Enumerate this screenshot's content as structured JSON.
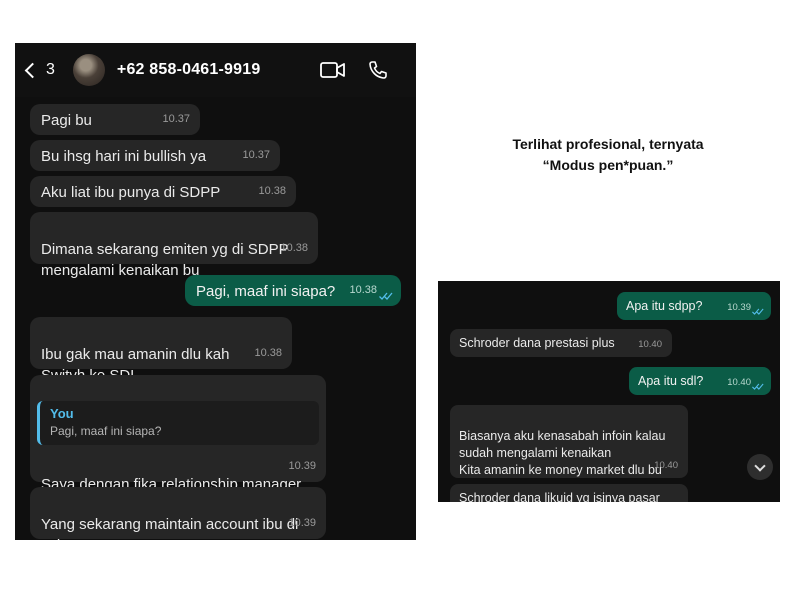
{
  "left_chat": {
    "header": {
      "back_count": "3",
      "contact": "+62 858-0461-9919",
      "icons": [
        "video-icon",
        "phone-icon"
      ]
    },
    "messages": [
      {
        "text": "Pagi bu",
        "time": "10.37",
        "direction": "in"
      },
      {
        "text": "Bu ihsg hari ini bullish ya",
        "time": "10.37",
        "direction": "in"
      },
      {
        "text": "Aku liat ibu punya di SDPP",
        "time": "10.38",
        "direction": "in"
      },
      {
        "text": "Dimana sekarang emiten yg di SDPP\nmengalami kenaikan bu",
        "time": "10.38",
        "direction": "in"
      },
      {
        "text": "Pagi, maaf ini siapa?",
        "time": "10.38",
        "direction": "out",
        "status": "read"
      },
      {
        "text": "Ibu gak mau amanin dlu kah\nSwitvh ke SDL",
        "time": "10.38",
        "direction": "in"
      },
      {
        "quote_author": "You",
        "quote_text": "Pagi, maaf ini siapa?",
        "text": "Saya dengan fika relationship manager\nbank ocbc bu",
        "time": "10.39",
        "direction": "in"
      },
      {
        "text": "Yang sekarang maintain account ibu di\nocbc",
        "time": "10.39",
        "direction": "in"
      }
    ]
  },
  "caption": {
    "line1": "Terlihat profesional, ternyata",
    "line2": "“Modus pen*puan.”"
  },
  "right_chat": {
    "messages": [
      {
        "text": "Apa itu sdpp?",
        "time": "10.39",
        "direction": "out",
        "status": "read"
      },
      {
        "text": "Schroder dana prestasi plus",
        "time": "10.40",
        "direction": "in"
      },
      {
        "text": "Apa itu sdl?",
        "time": "10.40",
        "direction": "out",
        "status": "read"
      },
      {
        "text": "Biasanya aku kenasabah infoin kalau\nsudah mengalami kenaikan\nKita amanin ke money market dlu bu",
        "time": "10.40",
        "direction": "in"
      },
      {
        "text": "Schroder dana likuid yg isinya pasar",
        "time": "",
        "direction": "in"
      }
    ],
    "scroll_button": "chevron-down-icon"
  },
  "colors": {
    "incoming_bubble": "#262626",
    "outgoing_bubble": "#0b5c47",
    "read_ticks": "#53bdeb",
    "background": "#0f0f0f"
  }
}
